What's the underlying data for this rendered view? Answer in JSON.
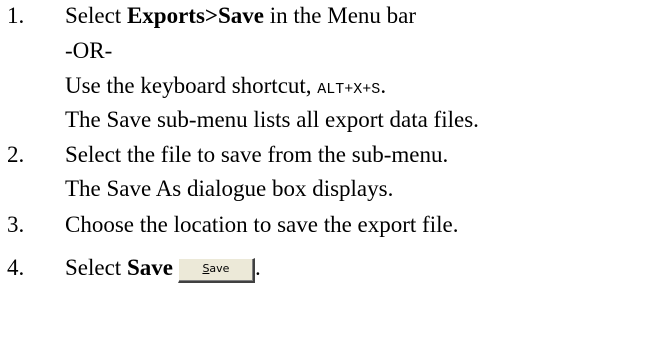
{
  "steps": [
    {
      "number": "1.",
      "line1": {
        "prefix": "Select ",
        "bold": "Exports>Save",
        "suffix": " in the Menu bar"
      },
      "or_text": "-OR-",
      "shortcut": {
        "prefix": "Use the keyboard shortcut, ",
        "keys": "ALT+X+S",
        "suffix": "."
      },
      "note": "The Save sub-menu lists all export data files."
    },
    {
      "number": "2.",
      "line1": "Select the file to save from the sub-menu.",
      "note": "The Save As dialogue box displays."
    },
    {
      "number": "3.",
      "line1": "Choose the location to save the export file."
    },
    {
      "number": "4.",
      "prefix": "Select ",
      "bold": "Save",
      "button": {
        "mnemonic": "S",
        "rest": "ave"
      },
      "suffix": "."
    }
  ]
}
